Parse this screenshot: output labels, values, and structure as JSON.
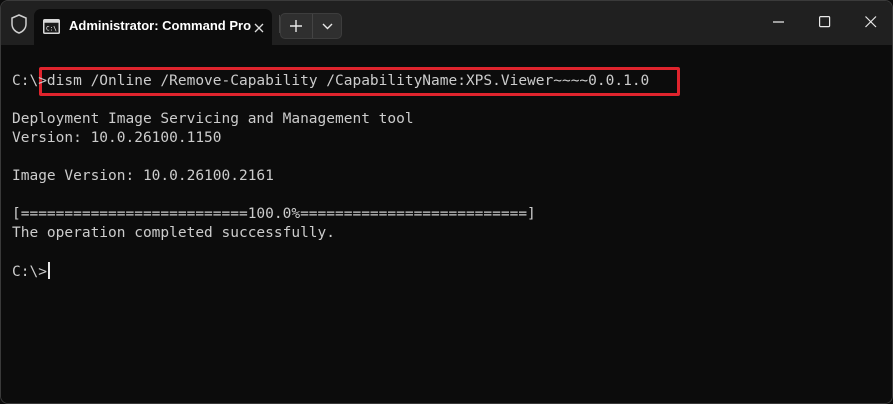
{
  "window": {
    "tab_title": "Administrator: Command Pro",
    "controls": [
      "minimize-icon",
      "maximize-icon",
      "close-icon"
    ]
  },
  "terminal": {
    "prompt": "C:\\>",
    "command": "dism /Online /Remove-Capability /CapabilityName:XPS.Viewer~~~~0.0.1.0",
    "output": [
      "Deployment Image Servicing and Management tool",
      "Version: 10.0.26100.1150",
      "",
      "Image Version: 10.0.26100.2161",
      "",
      "[==========================100.0%==========================]",
      "The operation completed successfully.",
      ""
    ],
    "final_prompt": "C:\\>",
    "progress": 1.0
  },
  "colors": {
    "highlight": "#e0242d",
    "text": "#cccccc",
    "background": "#0c0c0c"
  }
}
